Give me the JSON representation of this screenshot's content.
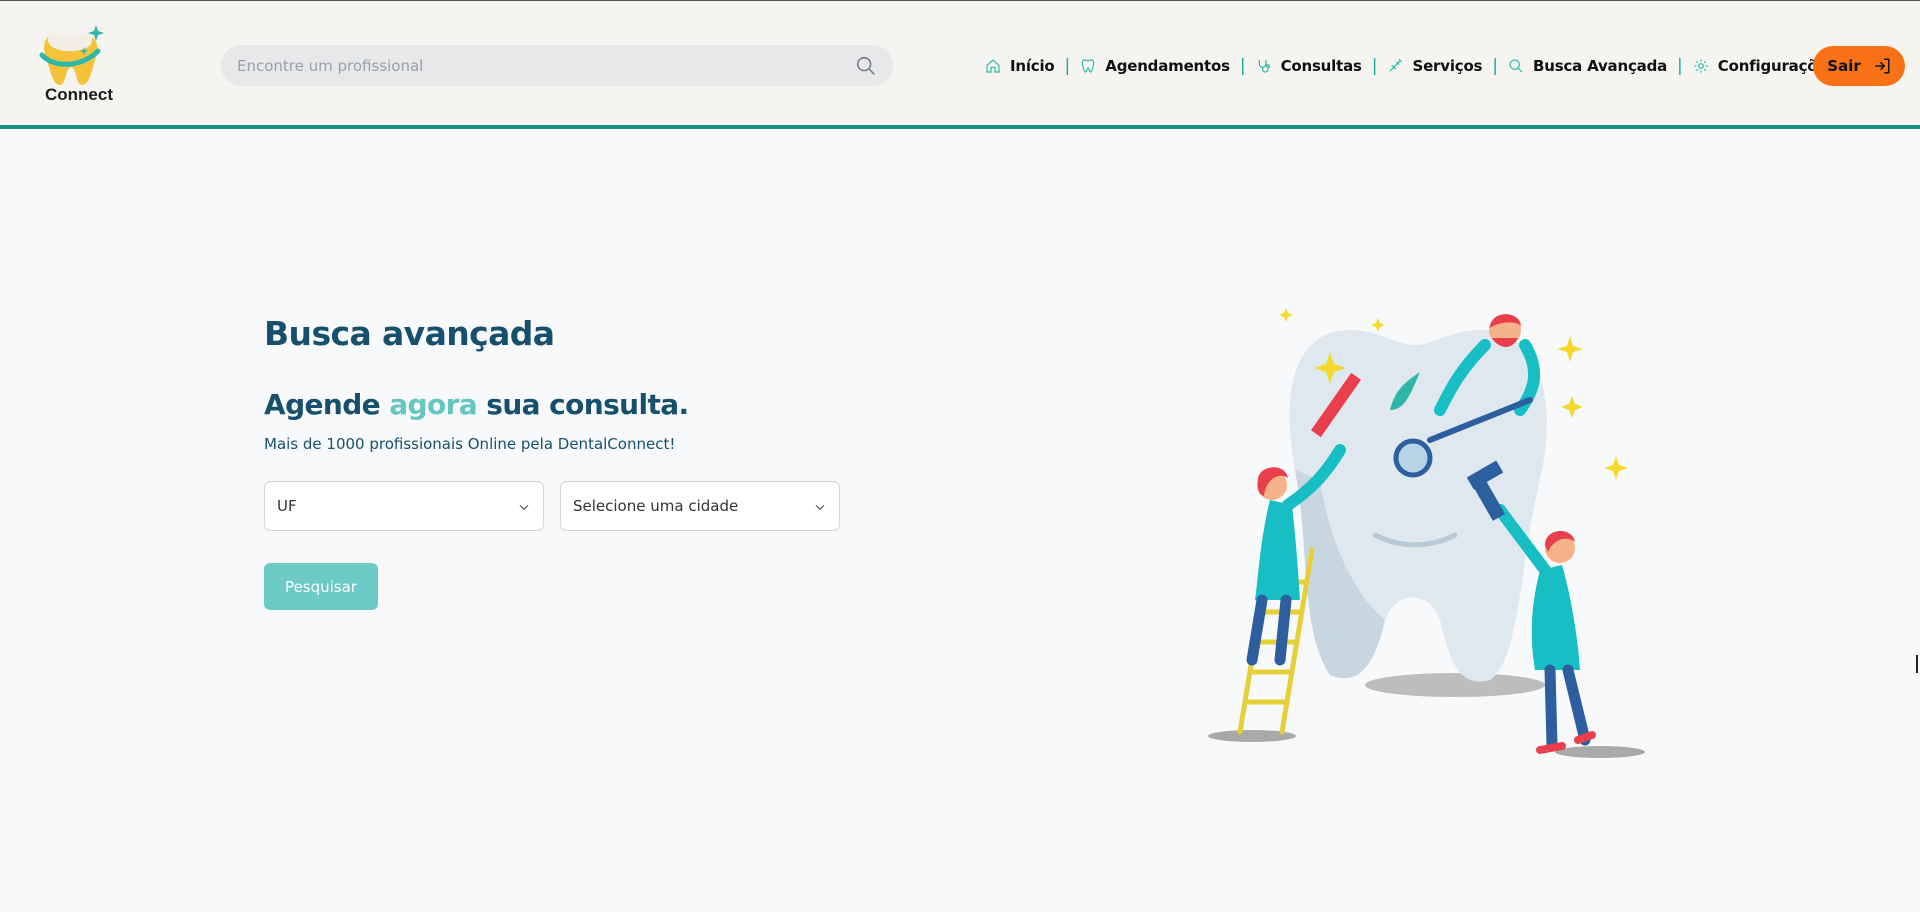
{
  "header": {
    "logo_text": "Connect",
    "search": {
      "placeholder": "Encontre um profissional",
      "value": ""
    },
    "nav": [
      {
        "label": "Início",
        "icon": "home-icon"
      },
      {
        "label": "Agendamentos",
        "icon": "tooth-icon"
      },
      {
        "label": "Consultas",
        "icon": "stethoscope-icon"
      },
      {
        "label": "Serviços",
        "icon": "syringe-icon"
      },
      {
        "label": "Busca Avançada",
        "icon": "search-icon"
      },
      {
        "label": "Configurações",
        "icon": "gear-icon"
      }
    ],
    "logout_label": "Sair"
  },
  "main": {
    "title": "Busca avançada",
    "headline": {
      "before": "Agende ",
      "accent": "agora",
      "after": " sua consulta."
    },
    "subtitle": "Mais de 1000 profissionais Online pela DentalConnect!",
    "uf_select": {
      "value": "UF",
      "options": [
        "UF"
      ]
    },
    "city_select": {
      "value": "Selecione uma cidade",
      "options": [
        "Selecione uma cidade"
      ]
    },
    "search_button": "Pesquisar"
  },
  "colors": {
    "header_bg": "#f5f4f1",
    "header_border": "#1a8f86",
    "title": "#17506d",
    "accent": "#66c6c0",
    "logout": "#f97316",
    "search_button": "#6ccbc6"
  }
}
